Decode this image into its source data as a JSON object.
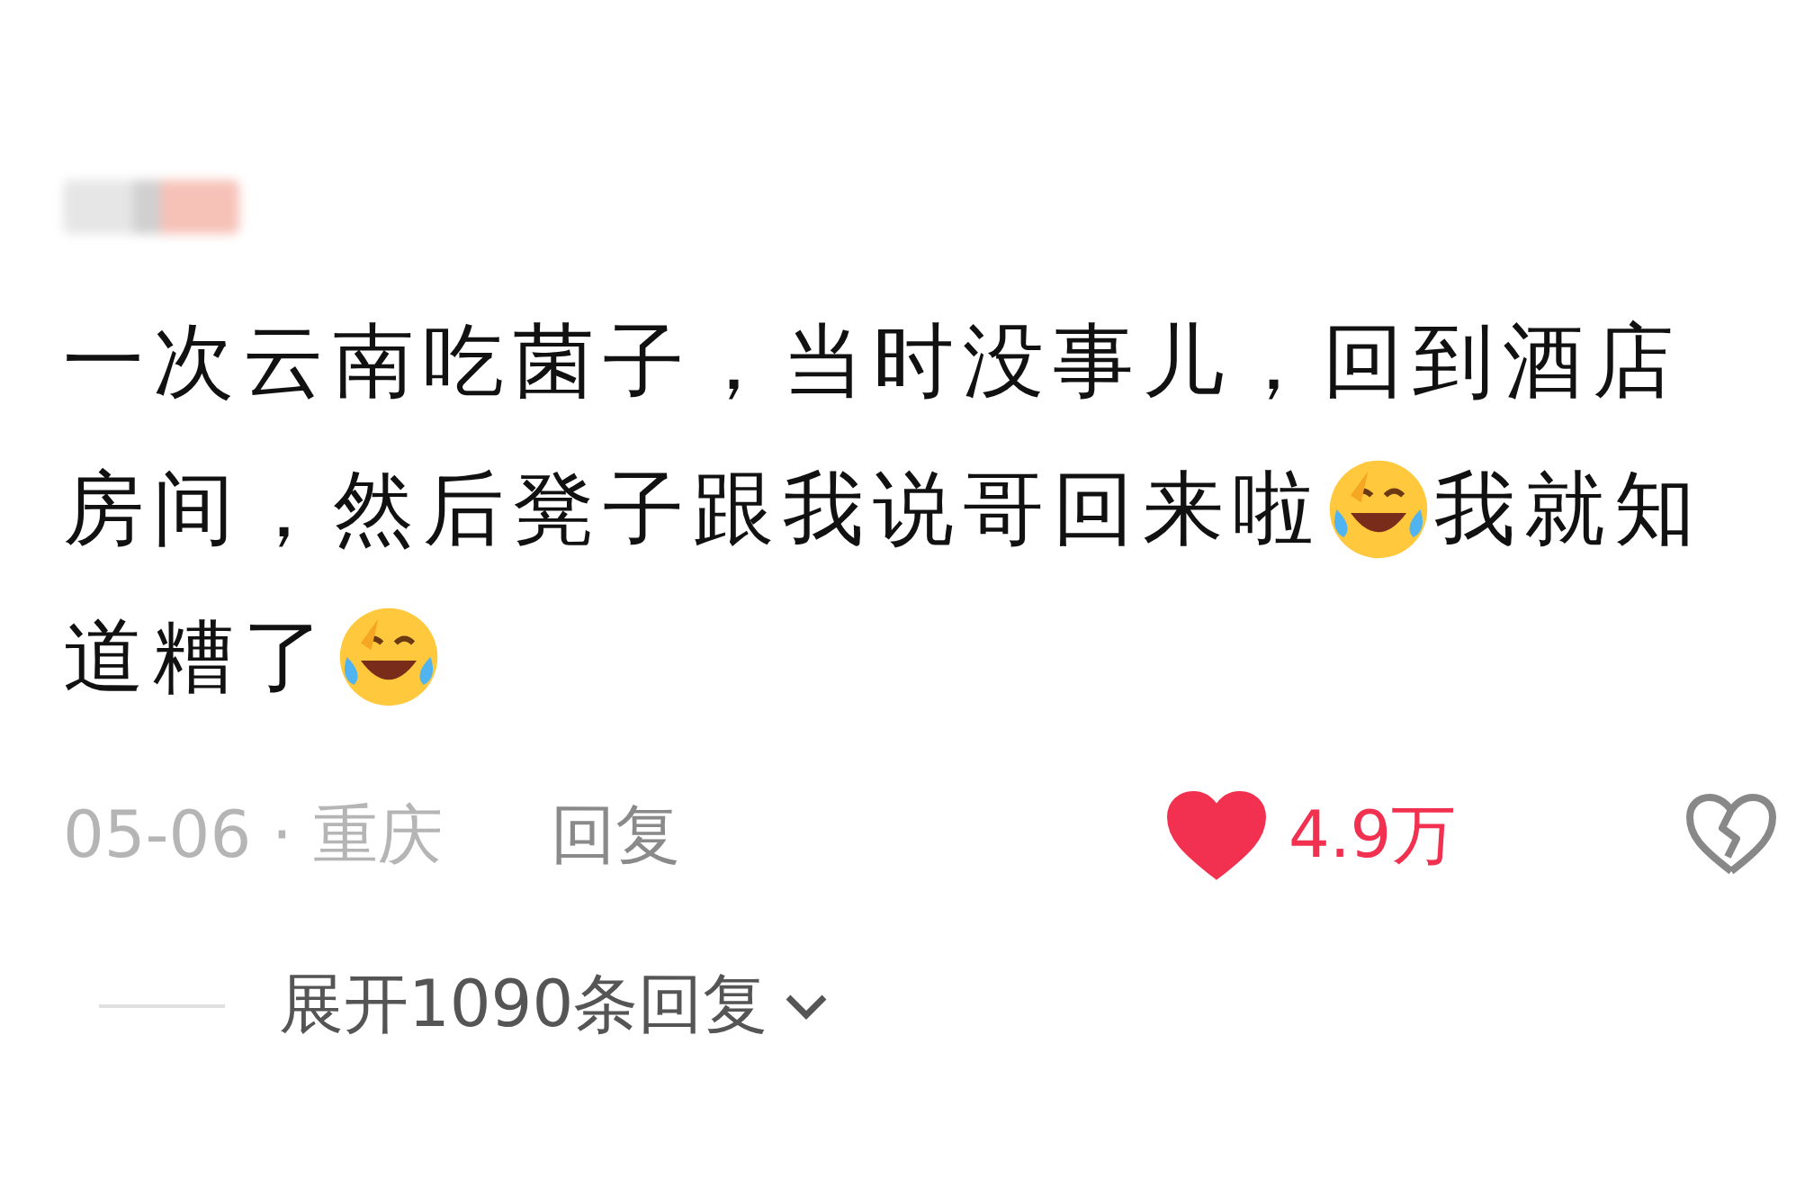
{
  "comment": {
    "lines": [
      [
        {
          "kind": "text",
          "text": "一次云南吃菌子，当时没事儿，回到酒店"
        }
      ],
      [
        {
          "kind": "text",
          "text": "房间，然后凳子跟我说哥回来啦"
        },
        {
          "kind": "emoji"
        },
        {
          "kind": "text",
          "text": "我就知"
        }
      ],
      [
        {
          "kind": "text",
          "text": "道糟了"
        },
        {
          "kind": "emoji"
        }
      ]
    ],
    "date": "05-06 · 重庆",
    "reply": "回复",
    "liked": true,
    "likes": "4.9万"
  },
  "expand": {
    "label": "展开1090条回复"
  }
}
